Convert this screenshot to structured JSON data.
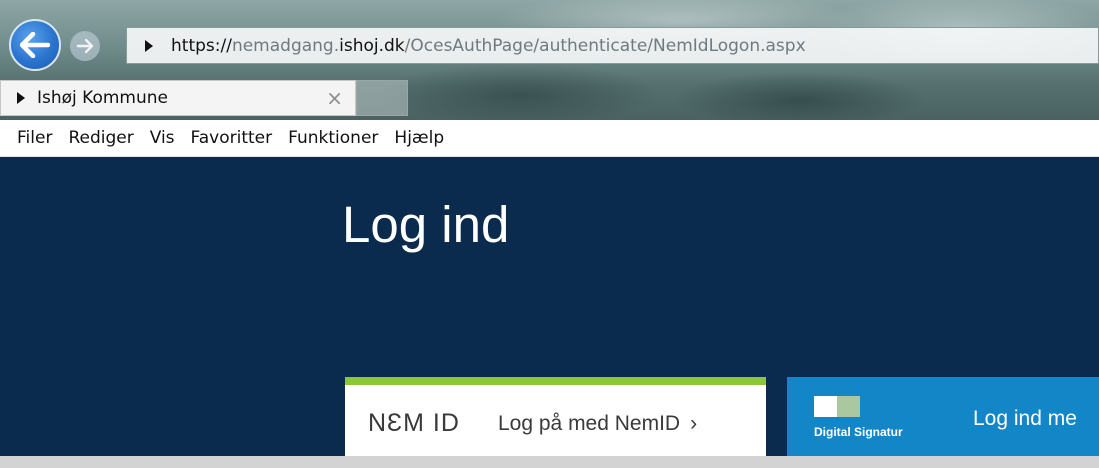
{
  "browser": {
    "address": {
      "scheme": "https://",
      "subdomain": "nemadgang.",
      "domain": "ishoj.dk",
      "path": "/OcesAuthPage/authenticate/NemIdLogon.aspx"
    },
    "tab": {
      "title": "Ishøj Kommune",
      "close_glyph": "×"
    },
    "menu": [
      "Filer",
      "Rediger",
      "Vis",
      "Favoritter",
      "Funktioner",
      "Hjælp"
    ],
    "icons": {
      "back": "arrow-left-icon",
      "forward": "arrow-right-icon"
    }
  },
  "page": {
    "title": "Log ind",
    "nemid": {
      "logo": "NƐM ID",
      "link_label": "Log på med NemID",
      "chevron": "›"
    },
    "digital_signatur": {
      "logo_text": "Digital Signatur",
      "link_label": "Log ind me"
    }
  },
  "colors": {
    "page_background": "#0b2b4e",
    "nemid_accent": "#8cc63f",
    "digital_signatur_background": "#1286c6"
  }
}
